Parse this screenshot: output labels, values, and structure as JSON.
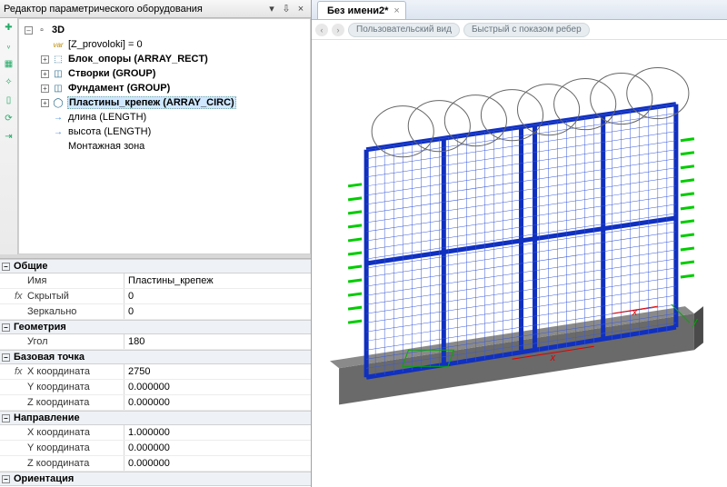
{
  "panel": {
    "title": "Редактор параметрического оборудования",
    "dropdown_glyph": "▾",
    "pin_glyph": "⇩",
    "close_glyph": "×"
  },
  "toolbar_icons": [
    "✚",
    "ᵥ",
    "▦",
    "✧",
    "▯",
    "⟳",
    "⇥"
  ],
  "tree": {
    "root": {
      "icon": "▫",
      "label": "3D"
    },
    "n1": {
      "icon": "var",
      "label": "[Z_provoloki] = 0"
    },
    "n2": {
      "icon": "⬚",
      "label": "Блок_опоры (ARRAY_RECT)"
    },
    "n3": {
      "icon": "◫",
      "label": "Створки (GROUP)"
    },
    "n4": {
      "icon": "◫",
      "label": "Фундамент (GROUP)"
    },
    "n5": {
      "icon": "◯",
      "label": "Пластины_крепеж (ARRAY_CIRC)"
    },
    "n6": {
      "icon": "→",
      "label": "длина (LENGTH)"
    },
    "n7": {
      "icon": "→",
      "label": "высота (LENGTH)"
    },
    "n8": {
      "icon": "",
      "label": "Монтажная зона"
    }
  },
  "props": {
    "cat_common": "Общие",
    "name_k": "Имя",
    "name_v": "Пластины_крепеж",
    "hidden_k": "Скрытый",
    "hidden_v": "0",
    "mirror_k": "Зеркально",
    "mirror_v": "0",
    "cat_geom": "Геометрия",
    "angle_k": "Угол",
    "angle_v": "180",
    "cat_bp": "Базовая точка",
    "bx_k": "X координата",
    "bx_v": "2750",
    "by_k": "Y координата",
    "by_v": "0.000000",
    "bz_k": "Z координата",
    "bz_v": "0.000000",
    "cat_dir": "Направление",
    "dx_k": "X координата",
    "dx_v": "1.000000",
    "dy_k": "Y координата",
    "dy_v": "0.000000",
    "dz_k": "Z координата",
    "dz_v": "0.000000",
    "cat_ori": "Ориентация"
  },
  "tabs": {
    "doc1": "Без имени2*"
  },
  "crumbs": {
    "back": "‹",
    "fwd": "›",
    "c1": "Пользовательский вид",
    "c2": "Быстрый с показом ребер"
  },
  "axes": {
    "x": "x",
    "y": "y"
  }
}
